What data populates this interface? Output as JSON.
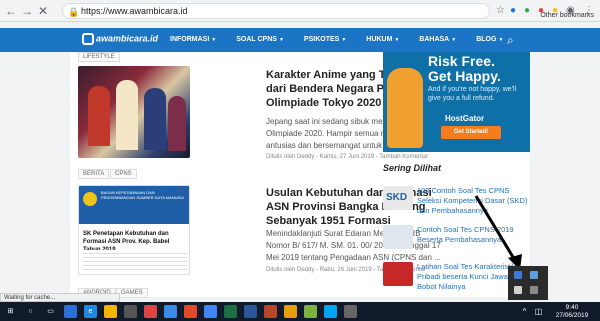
{
  "browser": {
    "url": "https://www.awambicara.id",
    "other_bookmarks": "Other bookmarks",
    "status": "Waiting for cache..."
  },
  "site": {
    "logo_text": "awambicara.id",
    "menu": [
      {
        "label": "INFORMASI"
      },
      {
        "label": "SOAL CPNS"
      },
      {
        "label": "PSIKOTES"
      },
      {
        "label": "HUKUM"
      },
      {
        "label": "BAHASA"
      },
      {
        "label": "BLOG"
      }
    ],
    "accent_color": "#1c74c4"
  },
  "articles": [
    {
      "tags": [
        "LIFESTYLE"
      ],
      "title": "Karakter Anime yang Terinspirasi dari Bendera Negara Peserta Olimpiade Tokyo 2020",
      "excerpt": "Jepang saat ini sedang sibuk mempersiapkan Olimpiade 2020. Hampir semua rakyatnya sangat antusias dan bersemangat untuk persiapan...",
      "meta": "Ditulis oleh Deddy  -  Kamis, 27 Juni 2019  -  Tambah Komentar"
    },
    {
      "tags": [
        "BERITA",
        "CPNS"
      ],
      "title": "Usulan Kebutuhan dan Formasi ASN Provinsi Bangka Belitung Sebanyak 1951 Formasi",
      "thumb_caption": "SK Penetapan Kebutuhan dan Formasi ASN Prov. Kep. Babel Tahun 2019",
      "thumb_header": "BADAN KEPEGAWAIAN DAN PENGEMBANGAN SUMBER DAYA MANUSIA",
      "excerpt": "Menindaklanjuti Surat Edaran Men PAN-RB Nomor B/ 617/ M. SM. 01. 00/ 2019 tertanggal 17 Mei 2019 tentang Pengadaan ASN (CPNS dan ...",
      "meta": "Ditulis oleh Deddy  -  Rabu, 26 Juni 2019  -  Tambah Komentar"
    },
    {
      "tags": [
        "ANDROID",
        "GAMES"
      ]
    }
  ],
  "ad": {
    "headline_1": "Risk Free.",
    "headline_2": "Get Happy.",
    "body": "And if you're not happy, we'll give you a full refund.",
    "brand": "HostGator",
    "cta": "Get Started!"
  },
  "sidebar": {
    "title": "Sering Dilihat",
    "items": [
      {
        "label": "100 Contoh Soal Tes CPNS Seleksi Kompetensi Dasar (SKD) dan Pembahasannya"
      },
      {
        "label": "Contoh Soal Tes CPNS 2019 Beserta Pembahasannya"
      },
      {
        "label": "Latihan Soal Tes Karakteristik Pribadi beserta Kunci Jawaban Bobot Nilainya"
      }
    ]
  },
  "taskbar": {
    "time": "9:40",
    "date": "27/06/2019"
  }
}
